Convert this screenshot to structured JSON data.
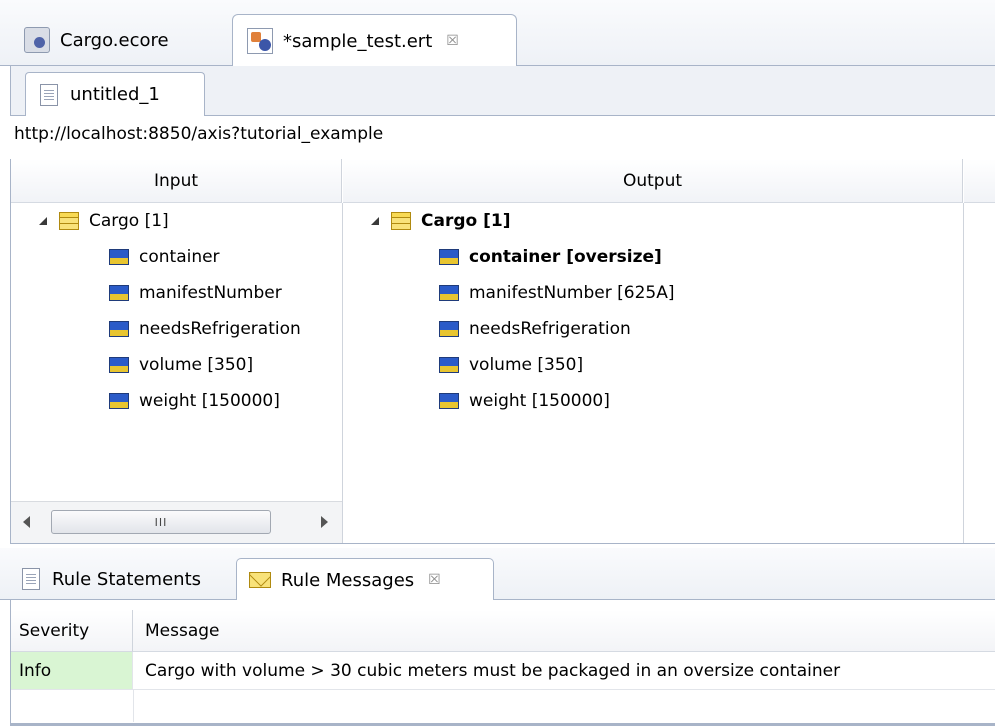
{
  "editor_tabs": [
    {
      "label": "Cargo.ecore",
      "icon": "ecore-model-icon",
      "active": false
    },
    {
      "label": "*sample_test.ert",
      "icon": "rule-test-icon",
      "active": true,
      "close": "☒"
    }
  ],
  "inner_tab": {
    "label": "untitled_1",
    "icon": "document-icon"
  },
  "url": "http://localhost:8850/axis?tutorial_example",
  "table": {
    "columns": [
      "Input",
      "Output",
      ""
    ],
    "input_tree": {
      "root": "Cargo [1]",
      "children": [
        "container",
        "manifestNumber",
        "needsRefrigeration",
        "volume [350]",
        "weight [150000]"
      ]
    },
    "output_tree": {
      "root": "Cargo [1]",
      "children": [
        "container [oversize]",
        "manifestNumber [625A]",
        "needsRefrigeration",
        "volume [350]",
        "weight [150000]"
      ]
    },
    "scroll_thumb": "III"
  },
  "view_tabs": [
    {
      "label": "Rule Statements",
      "icon": "document-icon",
      "active": false
    },
    {
      "label": "Rule Messages",
      "icon": "envelope-icon",
      "active": true,
      "close": "☒"
    }
  ],
  "messages": {
    "columns": [
      "Severity",
      "Message"
    ],
    "rows": [
      {
        "severity": "Info",
        "message": "Cargo with volume > 30 cubic meters must be packaged in an oversize container"
      }
    ]
  },
  "colors": {
    "info_bg": "#d9f5d3",
    "border": "#a8b4c8"
  }
}
